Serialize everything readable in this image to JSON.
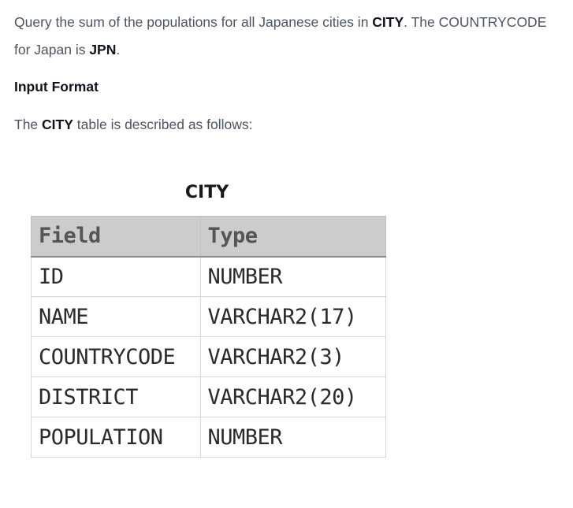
{
  "statement": {
    "part1": "Query the sum of the populations for all Japanese cities in ",
    "city": "CITY",
    "part2": ". The COUNTRYCODE for Japan is ",
    "jpn": "JPN",
    "part3": "."
  },
  "input_format": {
    "heading": "Input Format",
    "prefix": "The ",
    "table_name": "CITY",
    "suffix": " table is described as follows:"
  },
  "schema": {
    "caption": "CITY",
    "headers": [
      "Field",
      "Type"
    ],
    "rows": [
      {
        "field": "ID",
        "type": "NUMBER"
      },
      {
        "field": "NAME",
        "type": "VARCHAR2(17)"
      },
      {
        "field": "COUNTRYCODE",
        "type": "VARCHAR2(3)"
      },
      {
        "field": "DISTRICT",
        "type": "VARCHAR2(20)"
      },
      {
        "field": "POPULATION",
        "type": "NUMBER"
      }
    ]
  }
}
